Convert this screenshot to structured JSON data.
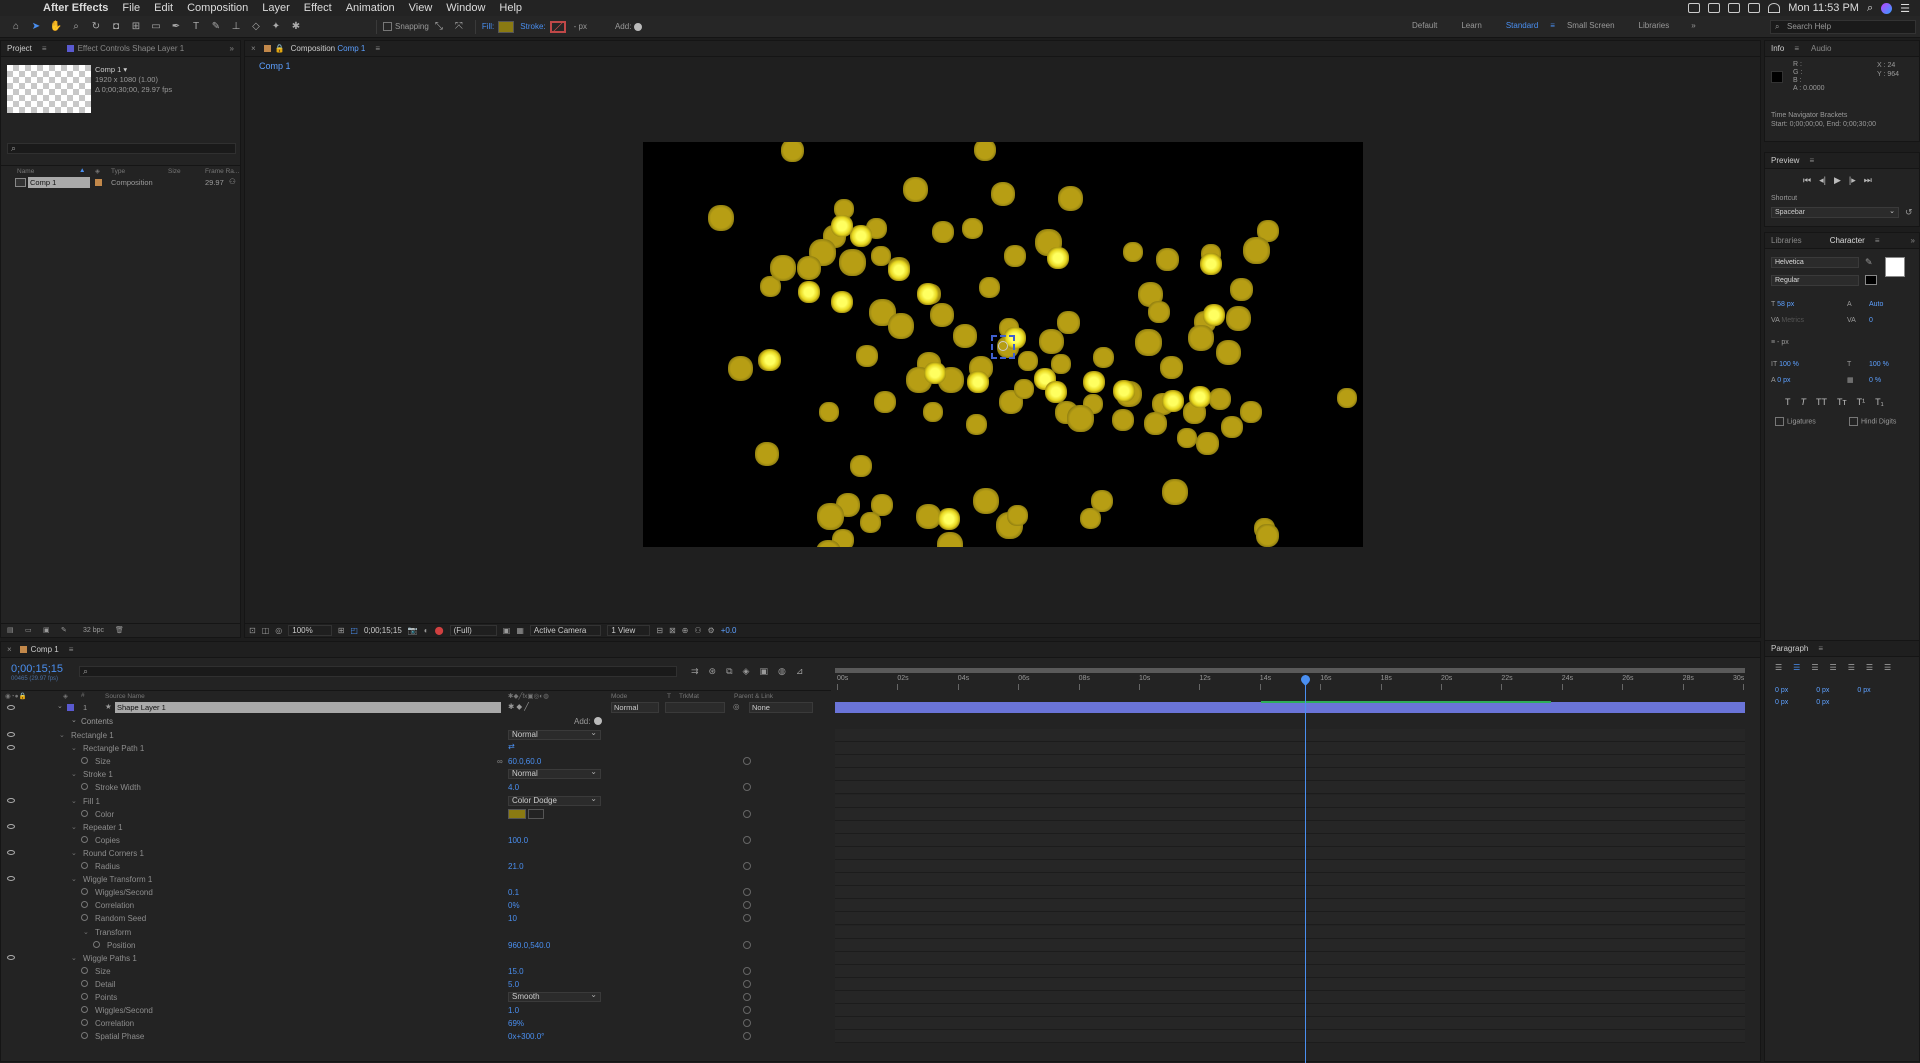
{
  "menubar": {
    "app": "After Effects",
    "items": [
      "File",
      "Edit",
      "Composition",
      "Layer",
      "Effect",
      "Animation",
      "View",
      "Window",
      "Help"
    ],
    "clock": "Mon 11:53 PM"
  },
  "toolbar": {
    "snapping": "Snapping",
    "fill": "Fill:",
    "stroke": "Stroke:",
    "px": "- px",
    "add": "Add:",
    "fill_color": "#8a7a12",
    "workspaces": [
      "Default",
      "Learn",
      "Standard",
      "Small Screen",
      "Libraries"
    ],
    "active_workspace": "Standard",
    "search": "Search Help"
  },
  "project": {
    "tab": "Project",
    "tab2": "Effect Controls Shape Layer 1",
    "comp_name": "Comp 1 ▾",
    "comp_size": "1920 x 1080 (1.00)",
    "comp_duration": "Δ 0;00;30;00, 29.97 fps",
    "columns": [
      "Name",
      "Type",
      "Size",
      "Frame Ra..."
    ],
    "item": {
      "name": "Comp 1",
      "type": "Composition",
      "fps": "29.97"
    },
    "bpc": "32 bpc"
  },
  "composition": {
    "tab": "Composition",
    "tab_comp": "Comp 1",
    "breadcrumb": "Comp 1",
    "zoom": "100%",
    "time": "0;00;15;15",
    "resolution": "(Full)",
    "camera": "Active Camera",
    "views": "1 View",
    "exposure": "+0.0"
  },
  "info": {
    "tab": "Info",
    "tab2": "Audio",
    "r": "R :",
    "g": "G :",
    "b": "B :",
    "a": "A : 0.0000",
    "x": "X : 24",
    "y": "Y : 964",
    "nav_title": "Time Navigator Brackets",
    "nav_range": "Start: 0;00;00;00, End: 0;00;30;00"
  },
  "preview": {
    "tab": "Preview",
    "shortcut_label": "Shortcut",
    "shortcut": "Spacebar"
  },
  "character": {
    "tab": "Libraries",
    "tab2": "Character",
    "font": "Helvetica",
    "style": "Regular",
    "size": "58 px",
    "leading": "Auto",
    "kerning": "Metrics",
    "tracking": "0",
    "stroke": "- px",
    "vscale": "100 %",
    "hscale": "100 %",
    "baseline": "0 px",
    "tsume": "0 %",
    "ligatures": "Ligatures",
    "hindi": "Hindi Digits"
  },
  "paragraph": {
    "tab": "Paragraph",
    "values": [
      "0 px",
      "0 px",
      "0 px",
      "0 px",
      "0 px"
    ]
  },
  "timeline": {
    "tab": "Comp 1",
    "time": "0;00;15;15",
    "frames": "00465 (29.97 fps)",
    "columns": {
      "source": "Source Name",
      "mode": "Mode",
      "t": "T",
      "trkmat": "TrkMat",
      "parent": "Parent & Link"
    },
    "ruler": [
      "00s",
      "02s",
      "04s",
      "06s",
      "08s",
      "10s",
      "12s",
      "14s",
      "16s",
      "18s",
      "20s",
      "22s",
      "24s",
      "26s",
      "28s",
      "30s"
    ],
    "playhead": 0.517,
    "layer": {
      "num": "1",
      "name": "Shape Layer 1",
      "mode": "Normal",
      "parent": "None"
    },
    "contents": "Contents",
    "add": "Add:",
    "props": [
      {
        "indent": 2,
        "tri": true,
        "eye": true,
        "label": "Rectangle 1",
        "dd": "Normal"
      },
      {
        "indent": 3,
        "tri": true,
        "eye": true,
        "label": "Rectangle Path 1",
        "val": ""
      },
      {
        "indent": 4,
        "stop": true,
        "label": "Size",
        "val": "60.0,60.0"
      },
      {
        "indent": 3,
        "tri": true,
        "eye": false,
        "label": "Stroke 1",
        "dd": "Normal"
      },
      {
        "indent": 4,
        "stop": true,
        "label": "Stroke Width",
        "val": "4.0"
      },
      {
        "indent": 3,
        "tri": true,
        "eye": true,
        "label": "Fill 1",
        "dd": "Color Dodge"
      },
      {
        "indent": 4,
        "stop": true,
        "label": "Color",
        "val": ""
      },
      {
        "indent": 3,
        "tri": true,
        "eye": true,
        "label": "Repeater 1",
        "val": ""
      },
      {
        "indent": 4,
        "stop": true,
        "label": "Copies",
        "val": "100.0"
      },
      {
        "indent": 3,
        "tri": true,
        "eye": true,
        "label": "Round Corners 1",
        "val": ""
      },
      {
        "indent": 4,
        "stop": true,
        "label": "Radius",
        "val": "21.0"
      },
      {
        "indent": 3,
        "tri": true,
        "eye": true,
        "label": "Wiggle Transform 1",
        "val": ""
      },
      {
        "indent": 4,
        "stop": true,
        "label": "Wiggles/Second",
        "val": "0.1"
      },
      {
        "indent": 4,
        "stop": true,
        "label": "Correlation",
        "val": "0%"
      },
      {
        "indent": 4,
        "stop": true,
        "label": "Random Seed",
        "val": "10"
      },
      {
        "indent": 4,
        "tri": true,
        "label": "Transform",
        "val": ""
      },
      {
        "indent": 5,
        "stop": true,
        "label": "Position",
        "val": "960.0,540.0"
      },
      {
        "indent": 3,
        "tri": true,
        "eye": true,
        "label": "Wiggle Paths 1",
        "val": ""
      },
      {
        "indent": 4,
        "stop": true,
        "label": "Size",
        "val": "15.0"
      },
      {
        "indent": 4,
        "stop": true,
        "label": "Detail",
        "val": "5.0"
      },
      {
        "indent": 4,
        "stop": true,
        "label": "Points",
        "dd": "Smooth"
      },
      {
        "indent": 4,
        "stop": true,
        "label": "Wiggles/Second",
        "val": "1.0"
      },
      {
        "indent": 4,
        "stop": true,
        "label": "Correlation",
        "val": "69%"
      },
      {
        "indent": 4,
        "stop": true,
        "label": "Spatial Phase",
        "val": "0x+300.0°"
      }
    ]
  }
}
